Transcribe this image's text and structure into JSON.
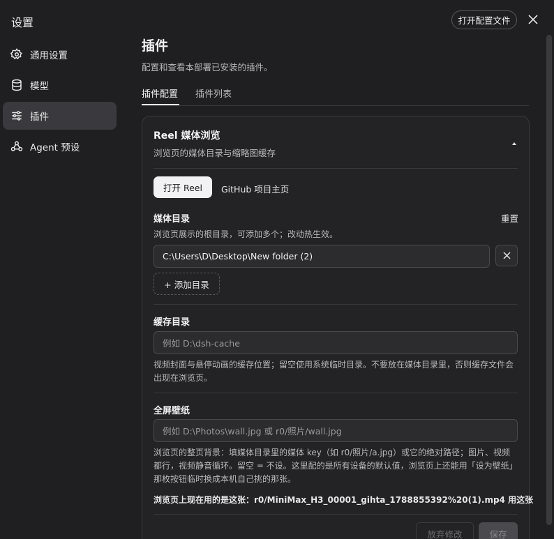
{
  "app": {
    "title": "设置"
  },
  "sidebar": {
    "items": [
      {
        "label": "通用设置",
        "icon": "gear-icon",
        "active": false
      },
      {
        "label": "模型",
        "icon": "database-icon",
        "active": false
      },
      {
        "label": "插件",
        "icon": "sliders-icon",
        "active": true
      },
      {
        "label": "Agent 预设",
        "icon": "agent-icon",
        "active": false
      }
    ]
  },
  "header": {
    "open_config_label": "打开配置文件",
    "close_icon": "close-icon"
  },
  "page": {
    "title": "插件",
    "subtitle": "配置和查看本部署已安装的插件。"
  },
  "tabs": [
    {
      "label": "插件配置",
      "active": true
    },
    {
      "label": "插件列表",
      "active": false
    }
  ],
  "plugin": {
    "title": "Reel 媒体浏览",
    "subtitle": "浏览页的媒体目录与缩略图缓存",
    "open_label": "打开 Reel",
    "github_label": "GitHub 项目主页",
    "media": {
      "label": "媒体目录",
      "reset_label": "重置",
      "help": "浏览页展示的根目录，可添加多个；改动热生效。",
      "value": "C:\\Users\\D\\Desktop\\New folder (2)",
      "add_label": "+ 添加目录"
    },
    "cache": {
      "label": "缓存目录",
      "placeholder": "例如 D:\\dsh-cache",
      "help": "视频封面与悬停动画的缓存位置；留空使用系统临时目录。不要放在媒体目录里，否则缓存文件会出现在浏览页。"
    },
    "wallpaper": {
      "label": "全屏壁纸",
      "placeholder": "例如 D:\\Photos\\wall.jpg 或 r0/照片/wall.jpg",
      "help": "浏览页的整页背景：填媒体目录里的媒体 key（如 r0/照片/a.jpg）或它的绝对路径；图片、视频都行，视频静音循环。留空 = 不设。这里配的是所有设备的默认值，浏览页上还能用「设为壁纸」那枚按钮临时换成本机自己挑的那张。",
      "current": "浏览页上现在用的是这张：r0/MiniMax_H3_00001_gihta_1788855392%20(1).mp4  用这张"
    },
    "discard_label": "放弃修改",
    "save_label": "保存"
  }
}
